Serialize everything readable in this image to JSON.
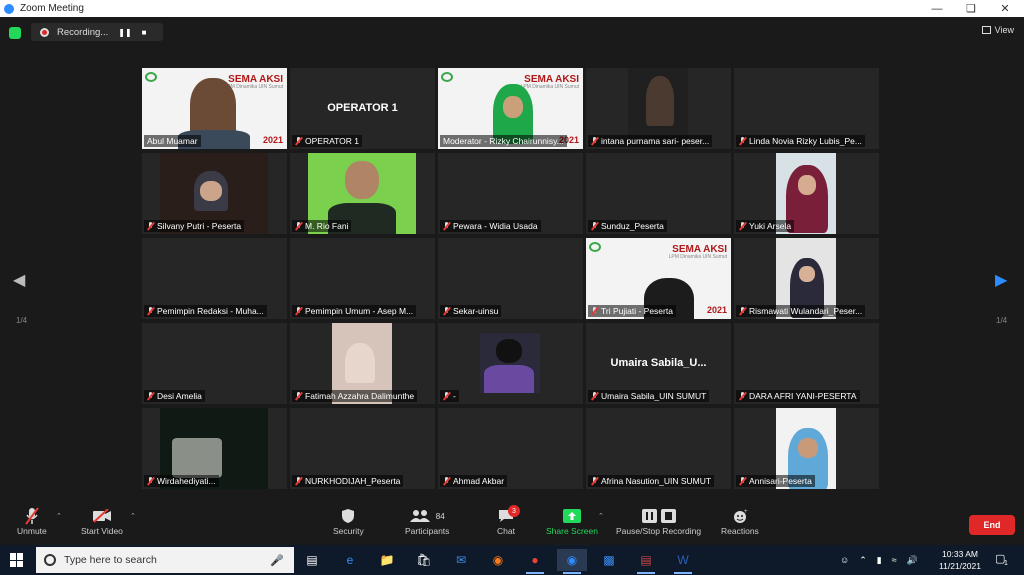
{
  "window": {
    "title": "Zoom Meeting"
  },
  "top": {
    "recording_label": "Recording...",
    "view_label": "View"
  },
  "paging": {
    "left": "1/4",
    "right": "1/4"
  },
  "tiles": [
    {
      "name": "Abul Muamar",
      "muted": false,
      "video": "sema-person"
    },
    {
      "name": "OPERATOR 1",
      "muted": true,
      "video": "name-card",
      "card": "OPERATOR 1"
    },
    {
      "name": "Moderator - Rizky Chairunnisy...",
      "muted": false,
      "video": "sema-hijab",
      "active": true
    },
    {
      "name": "intana purnama sari- peser...",
      "muted": true,
      "video": "dark-person"
    },
    {
      "name": "Linda Novia Rizky Lubis_Pe...",
      "muted": true,
      "video": "none"
    },
    {
      "name": "Silvany Putri - Peserta",
      "muted": true,
      "video": "person-room"
    },
    {
      "name": "M. Rio Fani",
      "muted": true,
      "video": "green-screen"
    },
    {
      "name": "Pewara - Widia Usada",
      "muted": true,
      "video": "none"
    },
    {
      "name": "Sunduz_Peserta",
      "muted": true,
      "video": "none"
    },
    {
      "name": "Yuki Arsela",
      "muted": true,
      "video": "hijab-portrait"
    },
    {
      "name": "Pemimpin Redaksi - Muha...",
      "muted": true,
      "video": "none"
    },
    {
      "name": "Pemimpin Umum - Asep M...",
      "muted": true,
      "video": "none"
    },
    {
      "name": "Sekar-uinsu",
      "muted": true,
      "video": "none"
    },
    {
      "name": "Tri Pujiati - Peserta",
      "muted": true,
      "video": "sema-dark"
    },
    {
      "name": "Rismawati Wulandari_Peser...",
      "muted": true,
      "video": "hijab-small"
    },
    {
      "name": "Desi Amelia",
      "muted": true,
      "video": "none"
    },
    {
      "name": "Fatimah Azzahra Dalimunthe",
      "muted": true,
      "video": "blur"
    },
    {
      "name": "-",
      "muted": true,
      "video": "graduate"
    },
    {
      "name": "Umaira Sabila_UIN SUMUT",
      "muted": true,
      "video": "name-card",
      "card": "Umaira  Sabila_U..."
    },
    {
      "name": "DARA AFRI YANI-PESERTA",
      "muted": true,
      "video": "none"
    },
    {
      "name": "Wirdahediyati...",
      "muted": true,
      "video": "outdoor"
    },
    {
      "name": "NURKHODIJAH_Peserta",
      "muted": true,
      "video": "none"
    },
    {
      "name": "Ahmad Akbar",
      "muted": true,
      "video": "none"
    },
    {
      "name": "Afrina Nasution_UIN SUMUT",
      "muted": true,
      "video": "none"
    },
    {
      "name": "Annisari-Peserta",
      "muted": true,
      "video": "hijab-blue"
    }
  ],
  "sema": {
    "brand": "SEMA AKSI",
    "sub": "LPM Dinamika UIN Sumut",
    "year": "2021"
  },
  "toolbar": {
    "unmute": "Unmute",
    "start_video": "Start Video",
    "security": "Security",
    "participants": "Participants",
    "participants_count": "84",
    "chat": "Chat",
    "chat_badge": "3",
    "share_screen": "Share Screen",
    "pause_stop": "Pause/Stop Recording",
    "reactions": "Reactions",
    "end": "End"
  },
  "taskbar": {
    "search_placeholder": "Type here to search",
    "time": "10:33 AM",
    "date": "11/21/2021",
    "notification_count": "1"
  },
  "colors": {
    "accent_green": "#23d959",
    "end_red": "#e02828",
    "active_outline": "#b8dc00",
    "zoom_blue": "#2d8cff"
  }
}
